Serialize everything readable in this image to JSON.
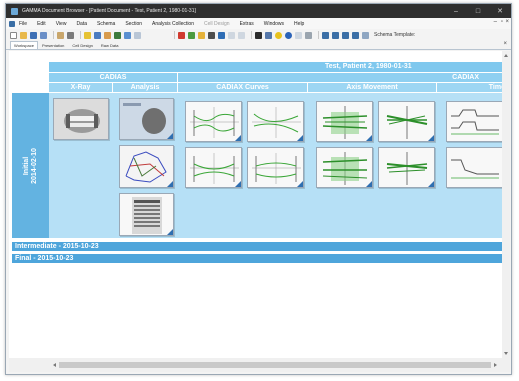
{
  "window": {
    "title": "GAMMA Document Browser - [Patient Document - Test, Patient 2, 1980-01-31]",
    "controls": {
      "minimize": "–",
      "maximize": "□",
      "close": "✕"
    }
  },
  "menu": {
    "items": [
      "File",
      "Edit",
      "View",
      "Data",
      "Schema",
      "Section",
      "Analysis Collection",
      "Cell Design",
      "Extras",
      "Windows",
      "Help"
    ],
    "mdi_controls": {
      "minimize": "–",
      "restore": "▫",
      "close": "×"
    }
  },
  "toolbar": {
    "schema_label": "Schema Template:"
  },
  "tabs": {
    "items": [
      "Workspace",
      "Presentation",
      "Cell Design",
      "Raw Data"
    ],
    "active": "Workspace",
    "close_glyph": "×"
  },
  "document": {
    "header": "Test, Patient 2, 1980-01-31",
    "groups": [
      "CADIAS",
      "CADIAX"
    ],
    "columns": [
      "X-Ray",
      "Analysis",
      "CADIAX Curves",
      "Axis Movement",
      "Time"
    ],
    "rows": [
      {
        "label_line1": "Initial",
        "label_line2": "2014-02-10"
      }
    ],
    "sections": [
      "Intermediate - 2015-10-23",
      "Final - 2015-10-23"
    ]
  },
  "colors": {
    "band_light": "#7fc8ee",
    "content_bg": "#b6e0f6",
    "row_header": "#63b3e1",
    "section_bar": "#4ea5db",
    "curve_green": "#3aa637",
    "corner_blue": "#2f6fb1"
  }
}
